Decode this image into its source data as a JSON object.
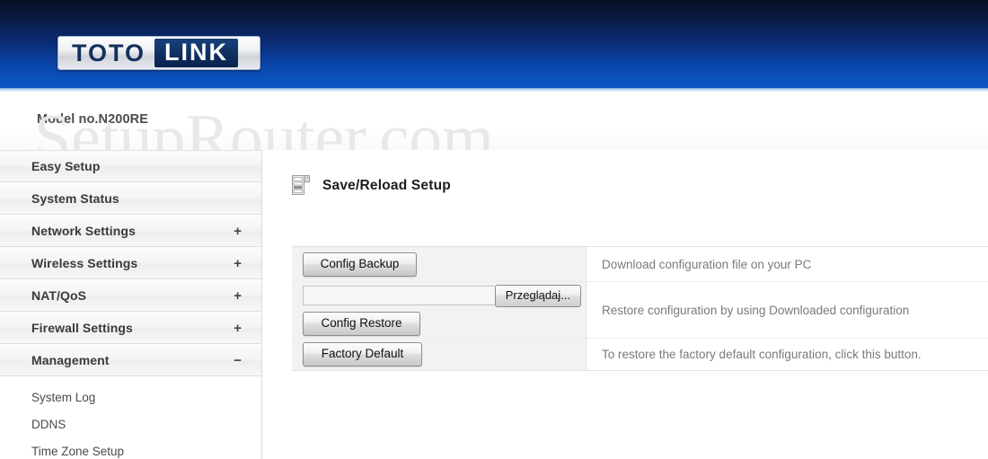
{
  "header": {
    "logo_first": "TOTO",
    "logo_second": "LINK",
    "model": "Model no.N200RE"
  },
  "watermark": "SetupRouter.com",
  "sidebar": {
    "items": [
      {
        "label": "Easy Setup",
        "sign": ""
      },
      {
        "label": "System Status",
        "sign": ""
      },
      {
        "label": "Network Settings",
        "sign": "+"
      },
      {
        "label": "Wireless Settings",
        "sign": "+"
      },
      {
        "label": "NAT/QoS",
        "sign": "+"
      },
      {
        "label": "Firewall Settings",
        "sign": "+"
      },
      {
        "label": "Management",
        "sign": "−"
      }
    ],
    "subitems": [
      {
        "label": "System Log"
      },
      {
        "label": "DDNS"
      },
      {
        "label": "Time Zone Setup"
      }
    ]
  },
  "main": {
    "page_title": "Save/Reload Setup",
    "page_icon": "list-document-icon",
    "rows": [
      {
        "button": "Config Backup",
        "description": "Download configuration file on your PC"
      },
      {
        "file_value": "",
        "file_placeholder": "",
        "browse_button": "Przeglądaj...",
        "button": "Config Restore",
        "description": "Restore configuration by using Downloaded configuration"
      },
      {
        "button": "Factory Default",
        "description": "To restore the factory default configuration, click this button."
      }
    ]
  },
  "colors": {
    "header_top": "#0a1024",
    "header_bottom": "#0b55c4",
    "logo_navy": "#12305c",
    "cell_bg": "#f2f2f2",
    "description_text": "#7a7a7a"
  }
}
